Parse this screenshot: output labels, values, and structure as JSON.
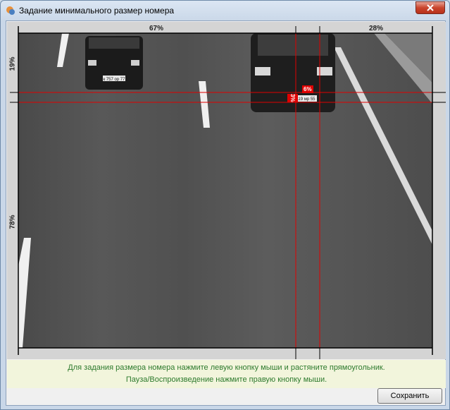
{
  "window": {
    "title": "Задание минимального размер номера",
    "close_icon": "close-icon",
    "app_icon": "app-icon"
  },
  "rulers": {
    "top_left_pct": "67%",
    "top_right_pct": "28%",
    "left_top_pct": "19%",
    "left_bottom_pct": "78%"
  },
  "selection": {
    "width_pct": "6%",
    "height_pct": "3%"
  },
  "plates": {
    "left_car": "к 757 ор 77",
    "right_car": "119 мр 55"
  },
  "hints": {
    "line1": "Для задания размера номера нажмите левую кнопку мыши и растяните прямоугольник.",
    "line2": "Пауза/Воспроизведение нажмите правую кнопку мыши."
  },
  "buttons": {
    "save": "Сохранить"
  },
  "colors": {
    "guide_lines": "#e00000",
    "hint_text": "#2d7a2d",
    "hint_bg": "#f2f5dc"
  }
}
